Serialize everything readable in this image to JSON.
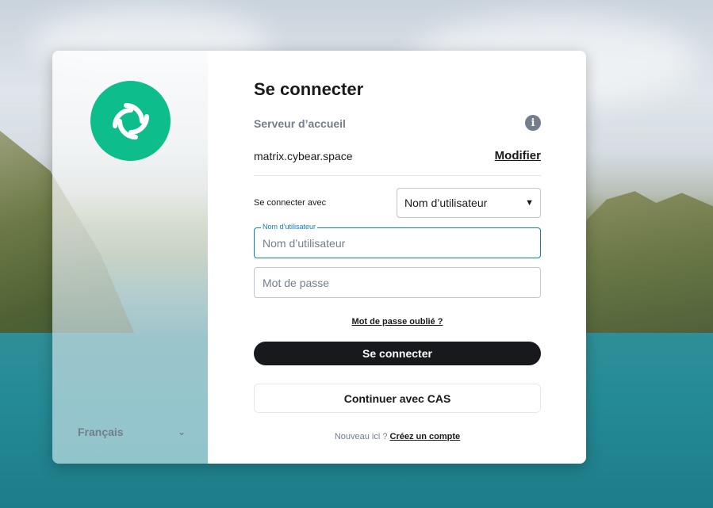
{
  "side": {
    "language": "Français"
  },
  "login": {
    "title": "Se connecter",
    "homeserver_label": "Serveur d’accueil",
    "homeserver_value": "matrix.cybear.space",
    "modify_label": "Modifier",
    "login_with_label": "Se connecter avec",
    "login_with_selected": "Nom d’utilisateur",
    "username_float_label": "Nom d’utilisateur",
    "username_placeholder": "Nom d’utilisateur",
    "username_value": "",
    "password_placeholder": "Mot de passe",
    "password_value": "",
    "forgot_password": "Mot de passe oublié ?",
    "submit_label": "Se connecter",
    "cas_label": "Continuer avec CAS",
    "new_here": "Nouveau ici ?",
    "create_account": "Créez un compte"
  },
  "colors": {
    "brand": "#0dbd8b",
    "focus": "#0a7fbf",
    "primary_button": "#17191c",
    "muted_text": "#737d8c"
  },
  "icons": {
    "logo": "element-logo-icon",
    "info": "info-icon",
    "language_chevron": "chevron-down-icon",
    "select_chevron": "chevron-down-icon"
  }
}
